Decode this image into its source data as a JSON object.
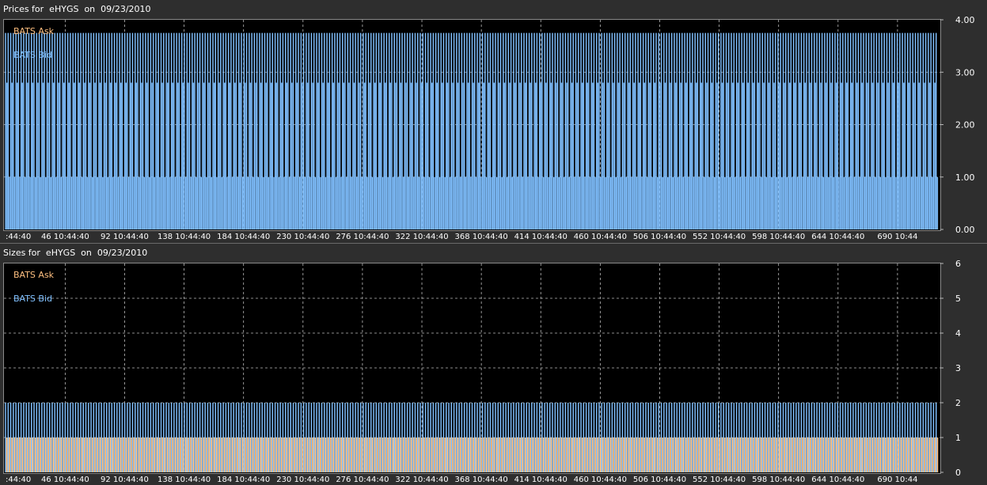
{
  "chart_data": [
    {
      "type": "bar",
      "title": "Prices for  eHYGS  on  09/23/2010",
      "y_ticks": [
        "4.00",
        "3.00",
        "2.00",
        "1.00",
        "0.00"
      ],
      "ylim": [
        0,
        4
      ],
      "x_ticks": [
        ":44:40",
        "46 10:44:40",
        "92 10:44:40",
        "138 10:44:40",
        "184 10:44:40",
        "230 10:44:40",
        "276 10:44:40",
        "322 10:44:40",
        "368 10:44:40",
        "414 10:44:40",
        "460 10:44:40",
        "506 10:44:40",
        "552 10:44:40",
        "598 10:44:40",
        "644 10:44:40",
        "690 10:44"
      ],
      "x_range": [
        1,
        720
      ],
      "grid": true,
      "legend_placement": "top-left",
      "series": [
        {
          "name": "BATS Ask",
          "color": "#ffc080",
          "value": 3.75
        },
        {
          "name": "BATS Bid",
          "color": "#80c0ff",
          "value": 2.8
        }
      ],
      "bid_pattern": "alternating 2.8 and 1.0 per tick"
    },
    {
      "type": "bar",
      "title": "Sizes for  eHYGS  on  09/23/2010",
      "y_ticks": [
        "6",
        "5",
        "4",
        "3",
        "2",
        "1",
        "0"
      ],
      "ylim": [
        0,
        6
      ],
      "x_ticks": [
        ":44:40",
        "46 10:44:40",
        "92 10:44:40",
        "138 10:44:40",
        "184 10:44:40",
        "230 10:44:40",
        "276 10:44:40",
        "322 10:44:40",
        "368 10:44:40",
        "414 10:44:40",
        "460 10:44:40",
        "506 10:44:40",
        "552 10:44:40",
        "598 10:44:40",
        "644 10:44:40",
        "690 10:44"
      ],
      "x_range": [
        1,
        720
      ],
      "grid": true,
      "legend_placement": "top-left",
      "series": [
        {
          "name": "BATS Ask",
          "color": "#ffc080",
          "value": 1
        },
        {
          "name": "BATS Bid",
          "color": "#80c0ff",
          "value": 2
        }
      ]
    }
  ]
}
